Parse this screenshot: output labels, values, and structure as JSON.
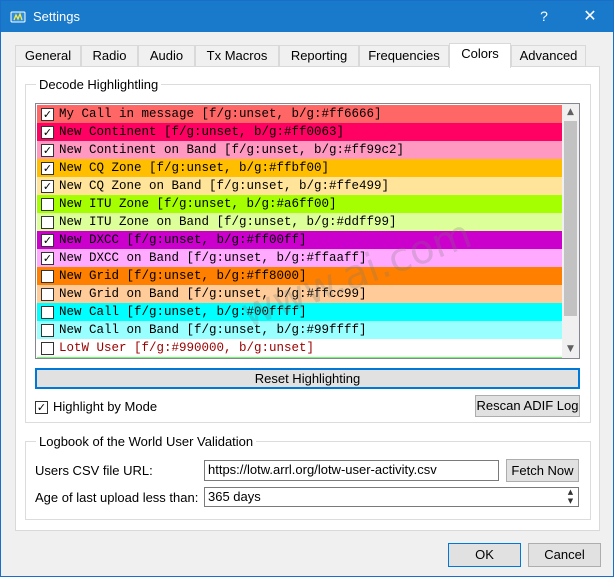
{
  "window": {
    "title": "Settings",
    "help_glyph": "?",
    "close_glyph": "✕",
    "accent": "#1979ca"
  },
  "tabs": [
    {
      "label": "General"
    },
    {
      "label": "Radio"
    },
    {
      "label": "Audio"
    },
    {
      "label": "Tx Macros"
    },
    {
      "label": "Reporting"
    },
    {
      "label": "Frequencies"
    },
    {
      "label": "Colors"
    },
    {
      "label": "Advanced"
    }
  ],
  "active_tab": "Colors",
  "decode": {
    "group_title": "Decode Highlightling",
    "items": [
      {
        "label": "My Call in message [f/g:unset, b/g:#ff6666]",
        "checked": true,
        "bg": "#ff6666",
        "fg": "#000000"
      },
      {
        "label": "New Continent [f/g:unset, b/g:#ff0063]",
        "checked": true,
        "bg": "#ff0063",
        "fg": "#000000"
      },
      {
        "label": "New Continent on Band [f/g:unset, b/g:#ff99c2]",
        "checked": true,
        "bg": "#ff99c2",
        "fg": "#000000"
      },
      {
        "label": "New CQ Zone [f/g:unset, b/g:#ffbf00]",
        "checked": true,
        "bg": "#ffbf00",
        "fg": "#000000"
      },
      {
        "label": "New CQ Zone on Band [f/g:unset, b/g:#ffe499]",
        "checked": true,
        "bg": "#ffe499",
        "fg": "#000000"
      },
      {
        "label": "New ITU Zone [f/g:unset, b/g:#a6ff00]",
        "checked": false,
        "bg": "#a6ff00",
        "fg": "#000000"
      },
      {
        "label": "New ITU Zone on Band [f/g:unset, b/g:#ddff99]",
        "checked": false,
        "bg": "#ddff99",
        "fg": "#000000"
      },
      {
        "label": "New DXCC [f/g:unset, b/g:#ff00ff]",
        "checked": true,
        "bg": "#cc00cc",
        "fg": "#000000"
      },
      {
        "label": "New DXCC on Band [f/g:unset, b/g:#ffaaff]",
        "checked": true,
        "bg": "#ffaaff",
        "fg": "#000000"
      },
      {
        "label": "New Grid [f/g:unset, b/g:#ff8000]",
        "checked": false,
        "bg": "#ff8000",
        "fg": "#000000"
      },
      {
        "label": "New Grid on Band [f/g:unset, b/g:#ffcc99]",
        "checked": false,
        "bg": "#ffcc99",
        "fg": "#000000"
      },
      {
        "label": "New Call [f/g:unset, b/g:#00ffff]",
        "checked": false,
        "bg": "#00ffff",
        "fg": "#000000"
      },
      {
        "label": "New Call on Band [f/g:unset, b/g:#99ffff]",
        "checked": false,
        "bg": "#99ffff",
        "fg": "#000000"
      },
      {
        "label": "LotW User [f/g:#990000, b/g:unset]",
        "checked": false,
        "bg": "#ffffff",
        "fg": "#990000"
      }
    ],
    "reset_label": "Reset Highlighting",
    "highlight_by_mode_label": "Highlight by Mode",
    "highlight_by_mode_checked": true,
    "rescan_label": "Rescan ADIF Log"
  },
  "lotw": {
    "group_title": "Logbook of the World User Validation",
    "csv_label": "Users CSV file URL:",
    "csv_value": "https://lotw.arrl.org/lotw-user-activity.csv",
    "fetch_label": "Fetch Now",
    "age_label": "Age of last upload less than:",
    "age_value": "365 days"
  },
  "footer": {
    "ok_label": "OK",
    "cancel_label": "Cancel"
  },
  "watermark": "www.ai.com"
}
